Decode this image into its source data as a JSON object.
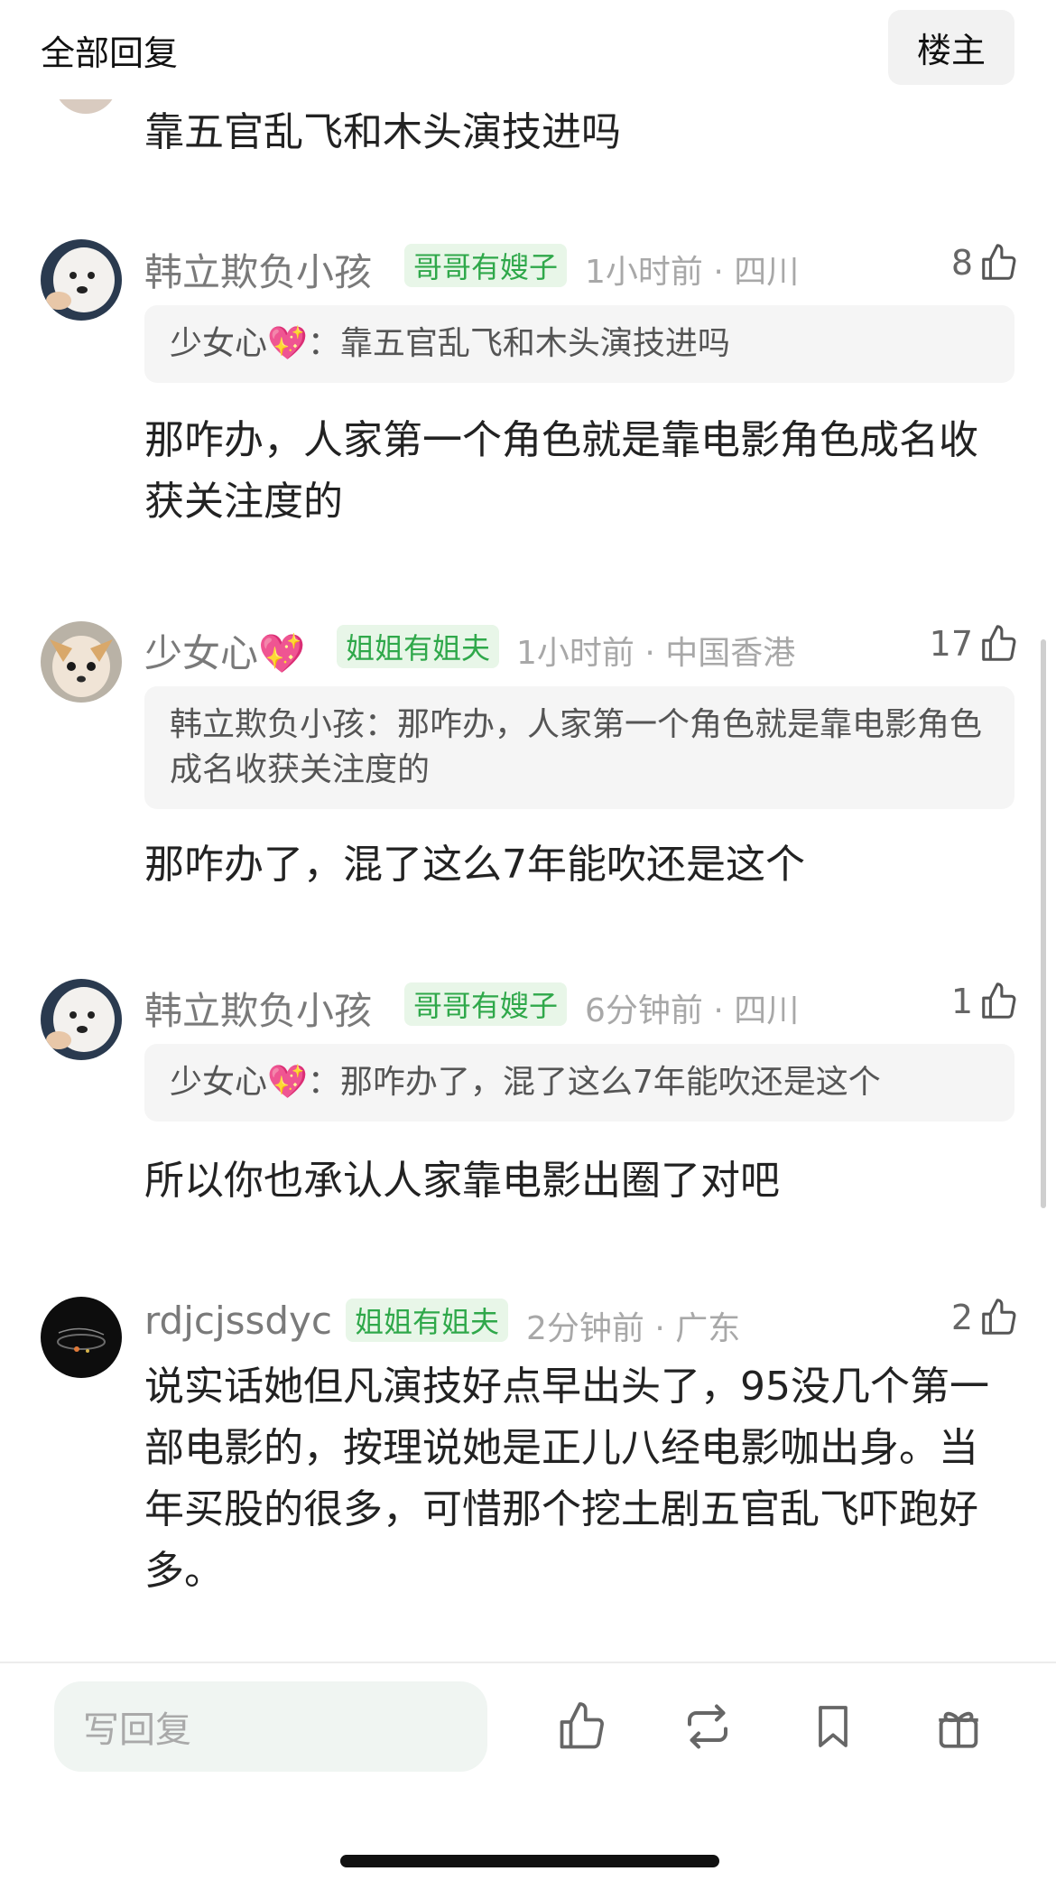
{
  "header": {
    "title": "全部回复",
    "owner_button": "楼主"
  },
  "top_comment": {
    "text": "靠五官乱飞和木头演技进吗"
  },
  "comments": [
    {
      "username": "韩立欺负小孩",
      "badge": "哥哥有嫂子",
      "meta": "1小时前 · 四川",
      "likes": "8",
      "quote_author": "少女心💖",
      "quote_text": "：靠五官乱飞和木头演技进吗",
      "text": "那咋办，人家第一个角色就是靠电影角色成名收获关注度的"
    },
    {
      "username": "少女心💖",
      "badge": "姐姐有姐夫",
      "meta": "1小时前 · 中国香港",
      "likes": "17",
      "quote_author": "韩立欺负小孩",
      "quote_text": "：那咋办，人家第一个角色就是靠电影角色成名收获关注度的",
      "text": "那咋办了，混了这么7年能吹还是这个"
    },
    {
      "username": "韩立欺负小孩",
      "badge": "哥哥有嫂子",
      "meta": "6分钟前 · 四川",
      "likes": "1",
      "quote_author": "少女心💖",
      "quote_text": "：那咋办了，混了这么7年能吹还是这个",
      "text": "所以你也承认人家靠电影出圈了对吧"
    },
    {
      "username": "rdjcjssdyc",
      "badge": "姐姐有姐夫",
      "meta": "2分钟前 · 广东",
      "likes": "2",
      "text": "说实话她但凡演技好点早出头了，95没几个第一部电影的，按理说她是正儿八经电影咖出身。当年买股的很多，可惜那个挖土剧五官乱飞吓跑好多。"
    }
  ],
  "bottom_bar": {
    "reply_placeholder": "写回复",
    "icons": [
      "thumbs-up-icon",
      "repost-icon",
      "bookmark-icon",
      "gift-icon"
    ]
  },
  "colors": {
    "badge_green": "#2fa84a",
    "badge_bg": "#e8f6e8",
    "meta_gray": "#a8a8a8"
  }
}
